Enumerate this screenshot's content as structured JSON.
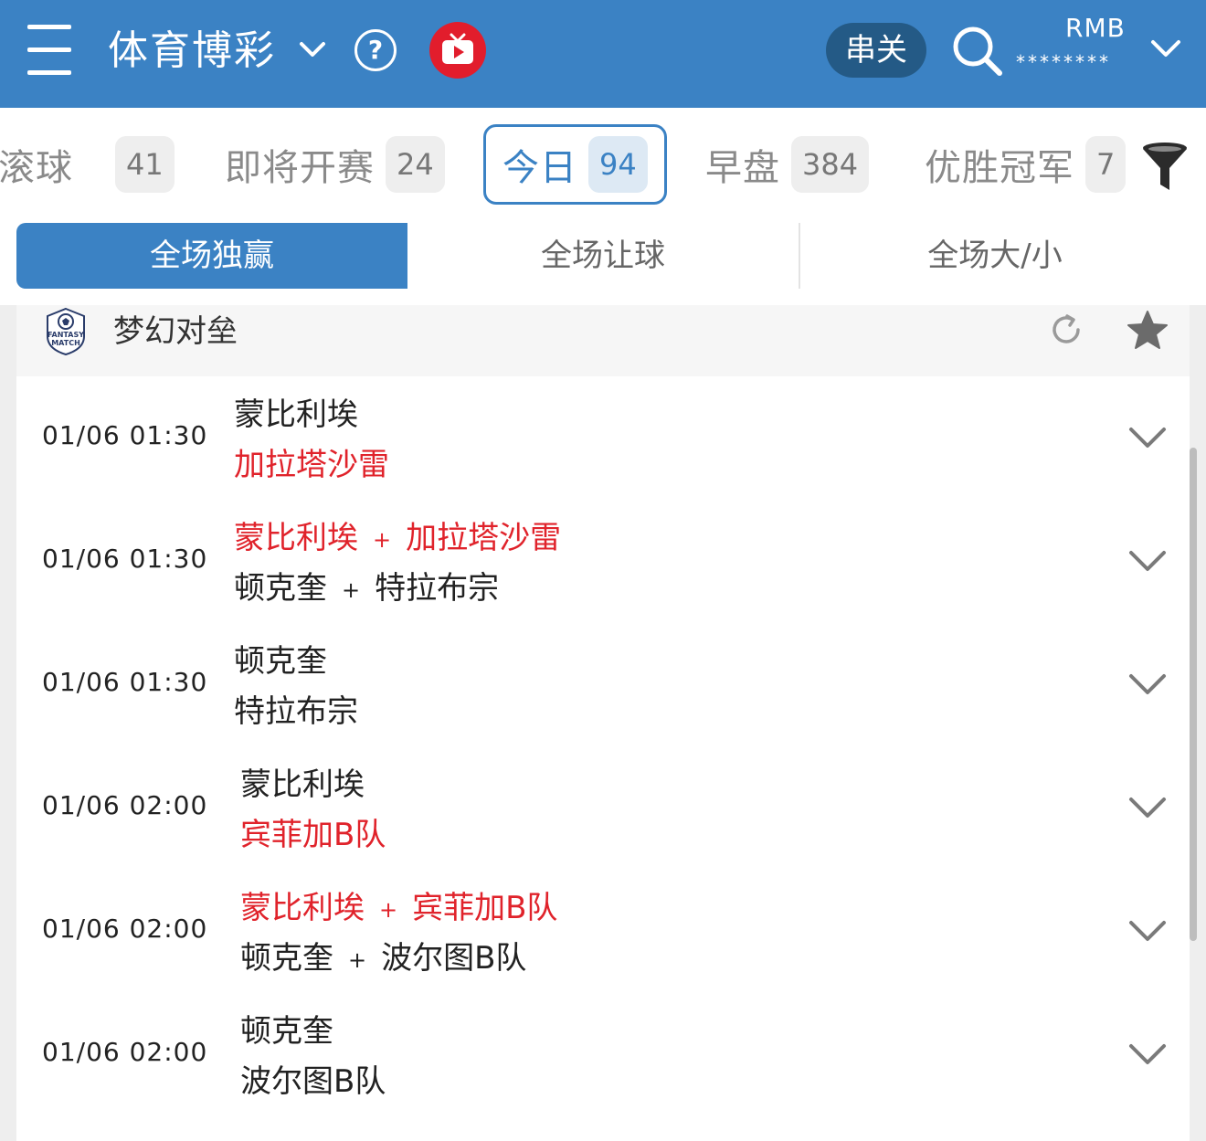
{
  "header": {
    "title": "体育博彩",
    "parlay_label": "串关",
    "currency": "RMB",
    "balance_masked": "********"
  },
  "categories": [
    {
      "label": "滚球",
      "count": "41"
    },
    {
      "label": "即将开赛",
      "count": "24"
    },
    {
      "label": "今日",
      "count": "94"
    },
    {
      "label": "早盘",
      "count": "384"
    },
    {
      "label": "优胜冠军",
      "count": "7"
    }
  ],
  "active_category": "今日",
  "market_tabs": [
    "全场独赢",
    "全场让球",
    "全场大/小"
  ],
  "league": {
    "logo_text": [
      "FANTASY",
      "MATCH"
    ],
    "name": "梦幻对垒"
  },
  "matches": [
    {
      "time": "01/06 01:30",
      "home": "蒙比利埃",
      "away": "加拉塔沙雷",
      "favored": "away"
    },
    {
      "time": "01/06 01:30",
      "home": "蒙比利埃 + 加拉塔沙雷",
      "away": "顿克奎 + 特拉布宗",
      "favored": "home"
    },
    {
      "time": "01/06 01:30",
      "home": "顿克奎",
      "away": "特拉布宗",
      "favored": "none"
    },
    {
      "time": "01/06 02:00",
      "home": "蒙比利埃",
      "away": "宾菲加B队",
      "favored": "away"
    },
    {
      "time": "01/06 02:00",
      "home": "蒙比利埃 + 宾菲加B队",
      "away": "顿克奎 + 波尔图B队",
      "favored": "home"
    },
    {
      "time": "01/06 02:00",
      "home": "顿克奎",
      "away": "波尔图B队",
      "favored": "none"
    }
  ],
  "colors": {
    "brand_blue": "#3b82c4",
    "favored_red": "#e0232b",
    "parlay_bg": "#245a86",
    "tv_red": "#e21d2c"
  },
  "icons": [
    "menu-icon",
    "chevron-down-icon",
    "help-icon",
    "tv-icon",
    "search-icon",
    "filter-icon",
    "fantasy-match-logo",
    "refresh-icon",
    "star-icon"
  ]
}
